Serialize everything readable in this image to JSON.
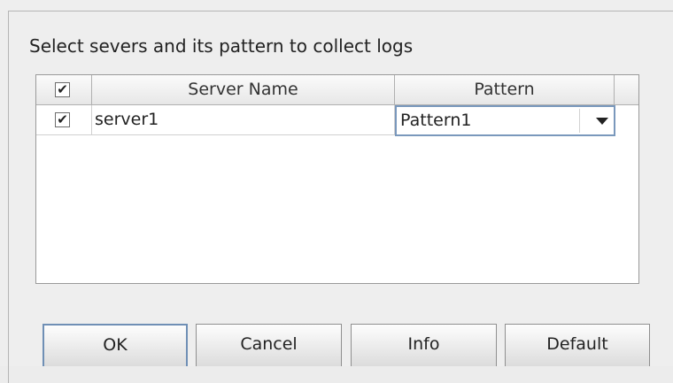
{
  "dialog": {
    "prompt": "Select severs and its pattern to collect logs"
  },
  "table": {
    "header_all_checked": "✔",
    "columns": [
      "Server Name",
      "Pattern"
    ],
    "rows": [
      {
        "checked": "✔",
        "server_name": "server1",
        "pattern": "Pattern1"
      }
    ]
  },
  "buttons": {
    "ok": "OK",
    "cancel": "Cancel",
    "info": "Info",
    "default": "Default"
  }
}
